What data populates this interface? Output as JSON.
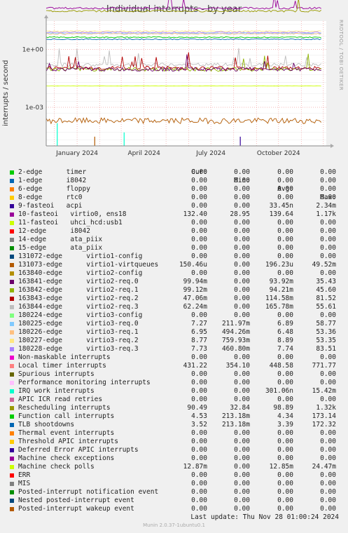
{
  "title": "Individual interrupts - by year",
  "side_label": "RRDTOOL / TOBI OETIKER",
  "footer": {
    "last_update": "Last update: Thu Nov 28 01:00:24 2024",
    "munin": "Munin 2.0.37-1ubuntu0.1"
  },
  "legend_header": {
    "cur": "Cur:",
    "min": "Min:",
    "avg": "Avg:",
    "max": "Max:"
  },
  "chart_data": {
    "type": "line",
    "title": "Individual interrupts - by year",
    "ylabel": "interrupts / second",
    "yscale": "log",
    "ylim": [
      1e-05,
      30
    ],
    "yticks": [
      "1e+00",
      "1e-03"
    ],
    "yticks_values": [
      1,
      0.001
    ],
    "xlim": [
      "2023-11-20",
      "2024-12-05"
    ],
    "xticks": [
      "January 2024",
      "April 2024",
      "July 2024",
      "October 2024"
    ],
    "xticks_values": [
      "2024-01-01",
      "2024-04-01",
      "2024-07-01",
      "2024-10-01"
    ],
    "grid": true,
    "series": [
      {
        "name": "2-edge      timer",
        "color": "#00cc00",
        "cur": "0.00",
        "min": "0.00",
        "avg": "0.00",
        "max": "0.00"
      },
      {
        "name": "1-edge      i8042",
        "color": "#0066b3",
        "cur": "0.00",
        "min": "0.00",
        "avg": "0.00",
        "max": "0.00"
      },
      {
        "name": "6-edge      floppy",
        "color": "#ff8000",
        "cur": "0.00",
        "min": "0.00",
        "avg": "0.00",
        "max": "0.00"
      },
      {
        "name": "8-edge      rtc0",
        "color": "#ffcc00",
        "cur": "0.00",
        "min": "0.00",
        "avg": "0.00",
        "max": "0.00"
      },
      {
        "name": "9-fasteoi   acpi",
        "color": "#330099",
        "cur": "0.00",
        "min": "0.00",
        "avg": "33.45n",
        "max": "2.34m"
      },
      {
        "name": "10-fasteoi   virtio0, ens18",
        "color": "#990099",
        "cur": "132.40",
        "min": "28.95",
        "avg": "139.64",
        "max": "1.17k"
      },
      {
        "name": "11-fasteoi   uhci_hcd:usb1",
        "color": "#ccff00",
        "cur": "0.00",
        "min": "0.00",
        "avg": "0.00",
        "max": "0.00"
      },
      {
        "name": "12-edge      i8042",
        "color": "#ff0000",
        "cur": "0.00",
        "min": "0.00",
        "avg": "0.00",
        "max": "0.00"
      },
      {
        "name": "14-edge      ata_piix",
        "color": "#808080",
        "cur": "0.00",
        "min": "0.00",
        "avg": "0.00",
        "max": "0.00"
      },
      {
        "name": "15-edge      ata_piix",
        "color": "#008f00",
        "cur": "0.00",
        "min": "0.00",
        "avg": "0.00",
        "max": "0.00"
      },
      {
        "name": "131072-edge      virtio1-config",
        "color": "#00487d",
        "cur": "0.00",
        "min": "0.00",
        "avg": "0.00",
        "max": "0.00"
      },
      {
        "name": "131073-edge      virtio1-virtqueues",
        "color": "#b35a00",
        "cur": "150.46u",
        "min": "0.00",
        "avg": "196.23u",
        "max": "49.52m"
      },
      {
        "name": "163840-edge      virtio2-config",
        "color": "#b38f00",
        "cur": "0.00",
        "min": "0.00",
        "avg": "0.00",
        "max": "0.00"
      },
      {
        "name": "163841-edge      virtio2-req.0",
        "color": "#6b006b",
        "cur": "99.94m",
        "min": "0.00",
        "avg": "93.92m",
        "max": "35.43"
      },
      {
        "name": "163842-edge      virtio2-req.1",
        "color": "#8fb300",
        "cur": "99.12m",
        "min": "0.00",
        "avg": "94.21m",
        "max": "45.60"
      },
      {
        "name": "163843-edge      virtio2-req.2",
        "color": "#b30000",
        "cur": "47.06m",
        "min": "0.00",
        "avg": "114.58m",
        "max": "81.52"
      },
      {
        "name": "163844-edge      virtio2-req.3",
        "color": "#bebebe",
        "cur": "62.24m",
        "min": "0.00",
        "avg": "165.78m",
        "max": "55.61"
      },
      {
        "name": "180224-edge      virtio3-config",
        "color": "#80ff80",
        "cur": "0.00",
        "min": "0.00",
        "avg": "0.00",
        "max": "0.00"
      },
      {
        "name": "180225-edge      virtio3-req.0",
        "color": "#80c9ff",
        "cur": "7.27",
        "min": "211.97m",
        "avg": "6.89",
        "max": "58.77"
      },
      {
        "name": "180226-edge      virtio3-req.1",
        "color": "#ffc080",
        "cur": "6.95",
        "min": "494.26m",
        "avg": "6.48",
        "max": "53.36"
      },
      {
        "name": "180227-edge      virtio3-req.2",
        "color": "#ffe680",
        "cur": "8.77",
        "min": "759.93m",
        "avg": "8.89",
        "max": "53.35"
      },
      {
        "name": "180228-edge      virtio3-req.3",
        "color": "#aa80ff",
        "cur": "7.73",
        "min": "460.80m",
        "avg": "7.74",
        "max": "83.51"
      },
      {
        "name": "Non-maskable interrupts",
        "color": "#ee00cc",
        "cur": "0.00",
        "min": "0.00",
        "avg": "0.00",
        "max": "0.00"
      },
      {
        "name": "Local timer interrupts",
        "color": "#ff8080",
        "cur": "431.22",
        "min": "354.10",
        "avg": "448.58",
        "max": "771.77"
      },
      {
        "name": "Spurious interrupts",
        "color": "#666600",
        "cur": "0.00",
        "min": "0.00",
        "avg": "0.00",
        "max": "0.00"
      },
      {
        "name": "Performance monitoring interrupts",
        "color": "#ffbfff",
        "cur": "0.00",
        "min": "0.00",
        "avg": "0.00",
        "max": "0.00"
      },
      {
        "name": "IRQ work interrupts",
        "color": "#00ffcc",
        "cur": "0.00",
        "min": "0.00",
        "avg": "301.06n",
        "max": "15.42m"
      },
      {
        "name": "APIC ICR read retries",
        "color": "#cc6699",
        "cur": "0.00",
        "min": "0.00",
        "avg": "0.00",
        "max": "0.00"
      },
      {
        "name": "Rescheduling interrupts",
        "color": "#999900",
        "cur": "90.49",
        "min": "32.84",
        "avg": "98.89",
        "max": "1.32k"
      },
      {
        "name": "Function call interrupts",
        "color": "#00cc00",
        "cur": "4.53",
        "min": "213.18m",
        "avg": "4.34",
        "max": "173.14"
      },
      {
        "name": "TLB shootdowns",
        "color": "#0066b3",
        "cur": "3.52",
        "min": "213.18m",
        "avg": "3.39",
        "max": "172.32"
      },
      {
        "name": "Thermal event interrupts",
        "color": "#ff8000",
        "cur": "0.00",
        "min": "0.00",
        "avg": "0.00",
        "max": "0.00"
      },
      {
        "name": "Threshold APIC interrupts",
        "color": "#ffcc00",
        "cur": "0.00",
        "min": "0.00",
        "avg": "0.00",
        "max": "0.00"
      },
      {
        "name": "Deferred Error APIC interrupts",
        "color": "#330099",
        "cur": "0.00",
        "min": "0.00",
        "avg": "0.00",
        "max": "0.00"
      },
      {
        "name": "Machine check exceptions",
        "color": "#990099",
        "cur": "0.00",
        "min": "0.00",
        "avg": "0.00",
        "max": "0.00"
      },
      {
        "name": "Machine check polls",
        "color": "#ccff00",
        "cur": "12.87m",
        "min": "0.00",
        "avg": "12.85m",
        "max": "24.47m"
      },
      {
        "name": "ERR",
        "color": "#ff0000",
        "cur": "0.00",
        "min": "0.00",
        "avg": "0.00",
        "max": "0.00"
      },
      {
        "name": "MIS",
        "color": "#808080",
        "cur": "0.00",
        "min": "0.00",
        "avg": "0.00",
        "max": "0.00"
      },
      {
        "name": "Posted-interrupt notification event",
        "color": "#008f00",
        "cur": "0.00",
        "min": "0.00",
        "avg": "0.00",
        "max": "0.00"
      },
      {
        "name": "Nested posted-interrupt event",
        "color": "#00487d",
        "cur": "0.00",
        "min": "0.00",
        "avg": "0.00",
        "max": "0.00"
      },
      {
        "name": "Posted-interrupt wakeup event",
        "color": "#b35a00",
        "cur": "0.00",
        "min": "0.00",
        "avg": "0.00",
        "max": "0.00"
      }
    ]
  }
}
